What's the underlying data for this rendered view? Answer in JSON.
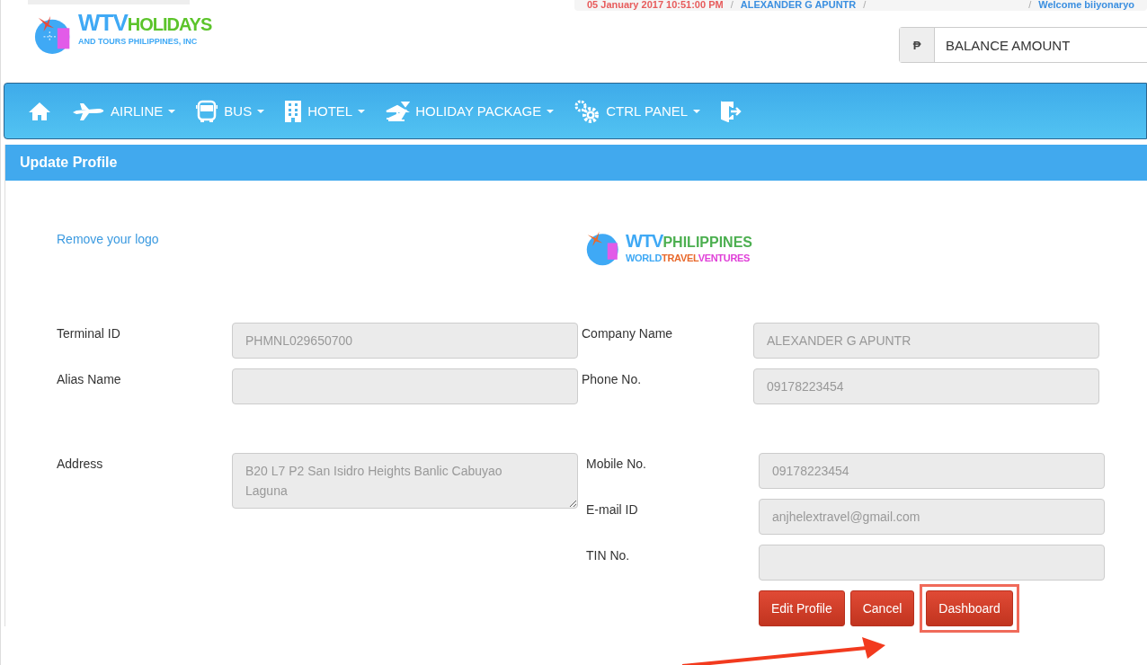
{
  "top_bar": {
    "left": [
      {
        "kind": "date",
        "text": "05 January 2017 10:51:00 PM"
      },
      {
        "kind": "sep",
        "text": "/"
      },
      {
        "kind": "link",
        "text": "ALEXANDER G APUNTR"
      },
      {
        "kind": "sep",
        "text": "/"
      }
    ],
    "right": [
      {
        "kind": "sep",
        "text": "/"
      },
      {
        "kind": "link",
        "text": "Welcome biiyonaryo"
      }
    ]
  },
  "brand_logo": {
    "parts": [
      {
        "text": "WTV",
        "color": "#3fa9f5"
      },
      {
        "text": "HOLIDAYS",
        "color": "#5cc42b"
      }
    ],
    "subtitle": "AND TOURS PHILIPPINES, INC"
  },
  "balance": {
    "currency": "₱",
    "value": "BALANCE AMOUNT"
  },
  "nav": {
    "items": [
      {
        "kind": "home",
        "caret": false
      },
      {
        "kind": "plane",
        "label": "AIRLINE",
        "caret": true
      },
      {
        "kind": "bus",
        "label": "BUS",
        "caret": true
      },
      {
        "kind": "hotel",
        "label": "HOTEL",
        "caret": true
      },
      {
        "kind": "package",
        "label": "HOLIDAY PACKAGE",
        "caret": true
      },
      {
        "kind": "gears",
        "label": "CTRL PANEL",
        "caret": true
      },
      {
        "kind": "logout",
        "caret": false
      }
    ]
  },
  "panel": {
    "title": "Update Profile",
    "remove_logo_link": "Remove your logo",
    "company_logo": {
      "parts": [
        {
          "text": "WTV",
          "color": "#3fa9f5"
        },
        {
          "text": "PHILIPPINES",
          "color": "#4caf50"
        }
      ],
      "subtitle_parts": [
        {
          "text": "WORLD",
          "color": "#3fa9f5"
        },
        {
          "text": "TRAVEL",
          "color": "#e8692c"
        },
        {
          "text": "VENTURES",
          "color": "#e040d8"
        }
      ]
    },
    "top_fields": [
      {
        "label": "Terminal ID",
        "value": "PHMNL029650700"
      },
      {
        "label": "Company Name",
        "value": "ALEXANDER G APUNTR"
      },
      {
        "label": "Alias Name"
      },
      {
        "label": "Phone No.",
        "value": "09178223454"
      }
    ],
    "address": {
      "label": "Address",
      "value": "B20 L7 P2 San Isidro Heights Banlic Cabuyao Laguna"
    },
    "right_fields": [
      {
        "label": "Mobile No.",
        "value": "09178223454"
      },
      {
        "label": "E-mail ID",
        "value": "anjhelextravel@gmail.com"
      },
      {
        "label": "TIN No."
      }
    ],
    "buttons": [
      {
        "label": "Edit Profile",
        "highlighted": false
      },
      {
        "label": "Cancel",
        "highlighted": false
      },
      {
        "label": "Dashboard",
        "highlighted": true
      }
    ]
  }
}
